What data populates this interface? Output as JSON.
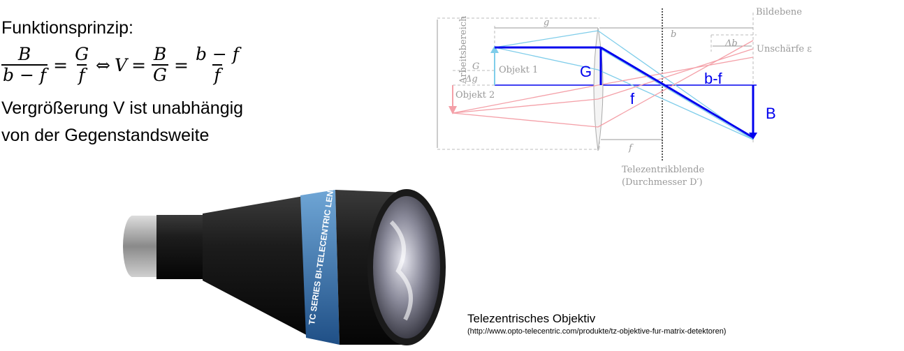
{
  "slide": {
    "heading": "Funktionsprinzip:",
    "formula": {
      "frac1_num": "B",
      "frac1_den": "b − f",
      "eq1": "=",
      "frac2_num": "G",
      "frac2_den": "f",
      "iff": "⇔",
      "v": "V",
      "eq2": "=",
      "frac3_num": "B",
      "frac3_den": "G",
      "eq3": "=",
      "frac4_num": "b − f",
      "frac4_den": "f"
    },
    "text_line1": "Vergrößerung V ist unabhängig",
    "text_line2": "von der Gegenstandsweite"
  },
  "diagram": {
    "label_bildebene": "Bildebene",
    "label_g": "g",
    "label_b": "b",
    "label_delta_b": "Δb",
    "label_unschaerfe": "Unschärfe ε",
    "label_arbeitsbereich": "Arbeitsbereich",
    "label_G_small": "G",
    "label_delta_g": "Δg",
    "label_objekt1": "Objekt 1",
    "label_objekt2": "Objekt 2",
    "label_G_big": "G",
    "label_f_big": "f",
    "label_bf_big": "b-f",
    "label_B_big": "B",
    "label_f_small": "f",
    "label_blende1": "Telezentrikblende",
    "label_blende2": "(Durchmesser D′)"
  },
  "photo": {
    "lens_text": "TC SERIES BI-TELECENTRIC LENSES",
    "caption": "Telezentrisches Objektiv",
    "source": "(http://www.opto-telecentric.com/produkte/tz-objektive-fur-matrix-detektoren)"
  },
  "colors": {
    "blue": "#0000ee",
    "light_blue": "#7fcdea",
    "pink": "#f4a0a8",
    "gray": "#999999"
  }
}
